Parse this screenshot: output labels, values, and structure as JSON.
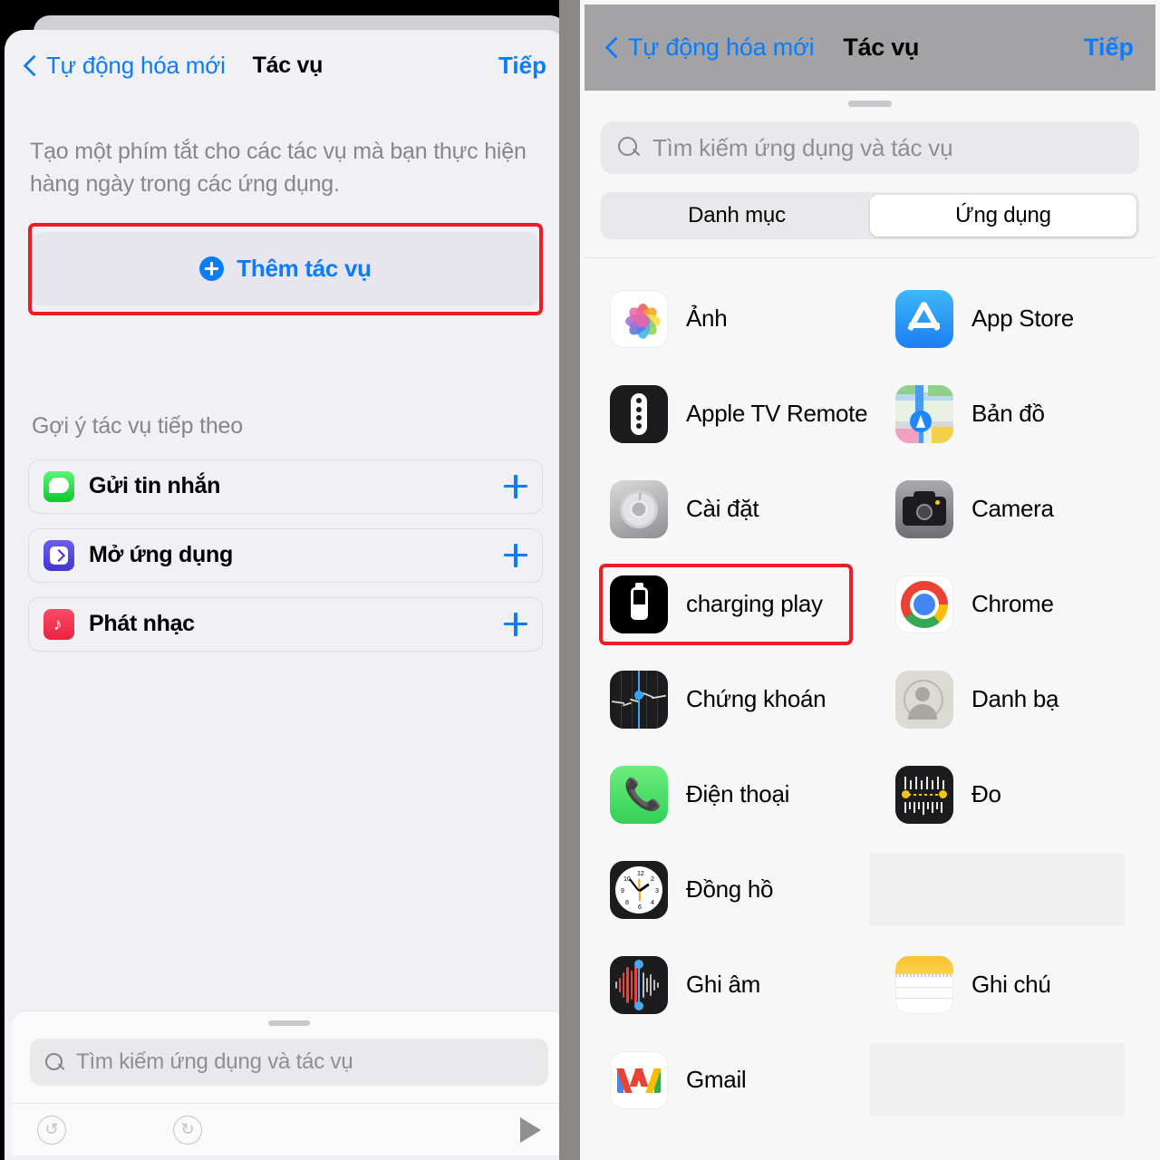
{
  "left": {
    "nav": {
      "back_label": "Tự động hóa mới",
      "title": "Tác vụ",
      "next_label": "Tiếp",
      "back_icon": "chevron-left-icon"
    },
    "description": "Tạo một phím tắt cho các tác vụ mà bạn thực hiện hàng ngày trong các ứng dụng.",
    "add_action": {
      "label": "Thêm tác vụ",
      "icon": "plus-circle-icon",
      "highlight_color": "#ee1c25"
    },
    "suggestions_title": "Gợi ý tác vụ tiếp theo",
    "suggestions": [
      {
        "label": "Gửi tin nhắn",
        "icon": "messages-icon",
        "add_icon": "plus-icon"
      },
      {
        "label": "Mở ứng dụng",
        "icon": "open-app-icon",
        "add_icon": "plus-icon"
      },
      {
        "label": "Phát nhạc",
        "icon": "music-icon",
        "add_icon": "plus-icon"
      }
    ],
    "search": {
      "placeholder": "Tìm kiếm ứng dụng và tác vụ",
      "icon": "search-icon"
    },
    "toolbar": {
      "undo_icon": "undo-icon",
      "undo_glyph": "↺",
      "redo_icon": "redo-icon",
      "redo_glyph": "↻",
      "play_icon": "play-icon"
    }
  },
  "right": {
    "nav": {
      "back_label": "Tự động hóa mới",
      "title": "Tác vụ",
      "next_label": "Tiếp",
      "back_icon": "chevron-left-icon"
    },
    "search": {
      "placeholder": "Tìm kiếm ứng dụng và tác vụ",
      "icon": "search-icon"
    },
    "segmented": {
      "options": [
        "Danh mục",
        "Ứng dụng"
      ],
      "selected": "Ứng dụng"
    },
    "apps": [
      {
        "label": "Ảnh",
        "icon": "photos-icon",
        "highlighted": false
      },
      {
        "label": "App Store",
        "icon": "app-store-icon",
        "highlighted": false
      },
      {
        "label": "Apple TV Remote",
        "icon": "apple-tv-remote-icon",
        "highlighted": false
      },
      {
        "label": "Bản đồ",
        "icon": "maps-icon",
        "highlighted": false
      },
      {
        "label": "Cài đặt",
        "icon": "settings-icon",
        "highlighted": false
      },
      {
        "label": "Camera",
        "icon": "camera-icon",
        "highlighted": false
      },
      {
        "label": "charging play",
        "icon": "battery-icon",
        "highlighted": true
      },
      {
        "label": "Chrome",
        "icon": "chrome-icon",
        "highlighted": false
      },
      {
        "label": "Chứng khoán",
        "icon": "stocks-icon",
        "highlighted": false
      },
      {
        "label": "Danh bạ",
        "icon": "contacts-icon",
        "highlighted": false
      },
      {
        "label": "Điện thoại",
        "icon": "phone-icon",
        "highlighted": false
      },
      {
        "label": "Đo",
        "icon": "measure-icon",
        "highlighted": false
      },
      {
        "label": "Đồng hồ",
        "icon": "clock-icon",
        "highlighted": false
      },
      {
        "label": "",
        "icon": "placeholder",
        "highlighted": false
      },
      {
        "label": "Ghi âm",
        "icon": "voice-memos-icon",
        "highlighted": false
      },
      {
        "label": "Ghi chú",
        "icon": "notes-icon",
        "highlighted": false
      },
      {
        "label": "Gmail",
        "icon": "gmail-icon",
        "highlighted": false
      },
      {
        "label": "",
        "icon": "placeholder",
        "highlighted": false
      }
    ],
    "highlight_color": "#ee1c25"
  }
}
